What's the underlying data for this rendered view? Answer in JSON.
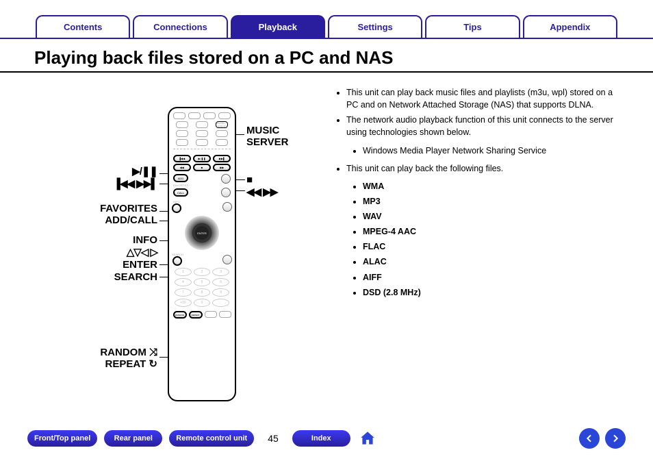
{
  "tabs": {
    "contents": "Contents",
    "connections": "Connections",
    "playback": "Playback",
    "settings": "Settings",
    "tips": "Tips",
    "appendix": "Appendix"
  },
  "title": "Playing back files stored on a PC and NAS",
  "callouts": {
    "play_pause": "▶/❚❚",
    "skip": "▐◀◀ ▶▶▌",
    "favorites": "FAVORITES",
    "addcall": "ADD/CALL",
    "info": "INFO",
    "cursors": "△▽◁ ▷",
    "enter": "ENTER",
    "search": "SEARCH",
    "random": "RANDOM ⤨",
    "repeat": "REPEAT ↻",
    "music_server_1": "MUSIC",
    "music_server_2": "SERVER",
    "stop": "■",
    "rew_ff": "◀◀ ▶▶"
  },
  "remote": {
    "enter": "ENTER",
    "add": "ADD",
    "call": "CALL",
    "favorites": "FAVORITES",
    "random": "RANDOM",
    "repeat": "REPEAT",
    "info_lbl": "INFO",
    "search_lbl": "SEARCH",
    "music_server": "MUSIC SERVER"
  },
  "bullets": {
    "b1": "This unit can play back music files and playlists (m3u, wpl) stored on a PC and on Network Attached Storage (NAS) that supports DLNA.",
    "b2": "The network audio playback function of this unit connects to the server using technologies shown below.",
    "b2a": "Windows Media Player Network Sharing Service",
    "b3": "This unit can play back the following files."
  },
  "formats": [
    "WMA",
    "MP3",
    "WAV",
    "MPEG-4 AAC",
    "FLAC",
    "ALAC",
    "AIFF",
    "DSD (2.8 MHz)"
  ],
  "bottom": {
    "front_top": "Front/Top panel",
    "rear": "Rear panel",
    "remote": "Remote control unit",
    "page": "45",
    "index": "Index"
  }
}
